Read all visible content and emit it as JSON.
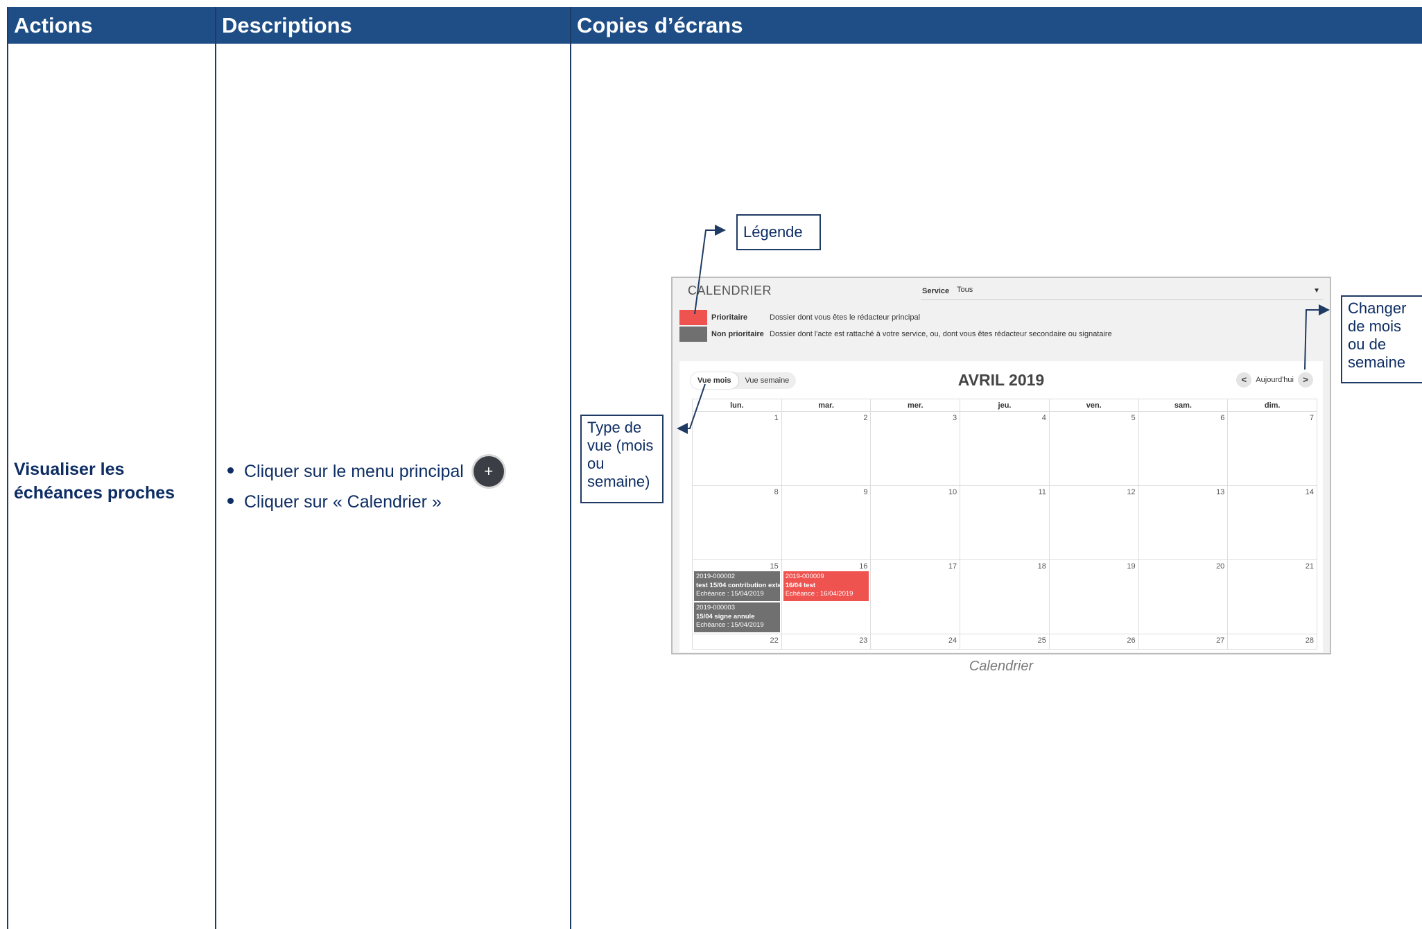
{
  "table": {
    "headers": {
      "actions": "Actions",
      "descriptions": "Descriptions",
      "screenshots": "Copies d’écrans"
    },
    "action": "Visualiser les échéances proches",
    "descriptions": [
      {
        "text": "Cliquer sur le menu principal",
        "icon": "plus-icon",
        "icon_glyph": "+"
      },
      {
        "text": "Cliquer sur « Calendrier »"
      }
    ]
  },
  "colors": {
    "header_bg": "#1f4e86",
    "text_blue": "#0d2d63",
    "prioritaire": "#ef5350",
    "non_prioritaire": "#707070"
  },
  "screenshot": {
    "title": "CALENDRIER",
    "service": {
      "label": "Service",
      "value": "Tous"
    },
    "legend": [
      {
        "name": "Prioritaire",
        "desc": "Dossier dont vous êtes le rédacteur principal",
        "color": "#ef5350"
      },
      {
        "name": "Non prioritaire",
        "desc": "Dossier dont l'acte est rattaché à votre service, ou, dont vous êtes rédacteur secondaire ou signataire",
        "color": "#707070"
      }
    ],
    "view_options": [
      "Vue mois",
      "Vue semaine"
    ],
    "active_view": "Vue mois",
    "month_title": "AVRIL 2019",
    "nav": {
      "prev": "<",
      "today": "Aujourd'hui",
      "next": ">"
    },
    "weekdays": [
      "lun.",
      "mar.",
      "mer.",
      "jeu.",
      "ven.",
      "sam.",
      "dim."
    ],
    "weeks": [
      [
        "1",
        "2",
        "3",
        "4",
        "5",
        "6",
        "7"
      ],
      [
        "8",
        "9",
        "10",
        "11",
        "12",
        "13",
        "14"
      ],
      [
        "15",
        "16",
        "17",
        "18",
        "19",
        "20",
        "21"
      ],
      [
        "22",
        "23",
        "24",
        "25",
        "26",
        "27",
        "28"
      ]
    ],
    "events": [
      {
        "week": 2,
        "day": 0,
        "slot": 0,
        "type": "non_prioritaire",
        "id": "2019-000002",
        "title": "test 15/04 contribution exte",
        "due": "Echéance : 15/04/2019"
      },
      {
        "week": 2,
        "day": 0,
        "slot": 1,
        "type": "non_prioritaire",
        "id": "2019-000003",
        "title": "15/04 signe annule",
        "due": "Echéance : 15/04/2019"
      },
      {
        "week": 2,
        "day": 1,
        "slot": 0,
        "type": "prioritaire",
        "id": "2019-000009",
        "title": "16/04 test",
        "due": "Echéance : 16/04/2019"
      }
    ],
    "caption": "Calendrier"
  },
  "callouts": {
    "legend": "Légende",
    "change_month": "Changer de mois ou de semaine",
    "view_type": "Type de vue (mois ou semaine)"
  }
}
